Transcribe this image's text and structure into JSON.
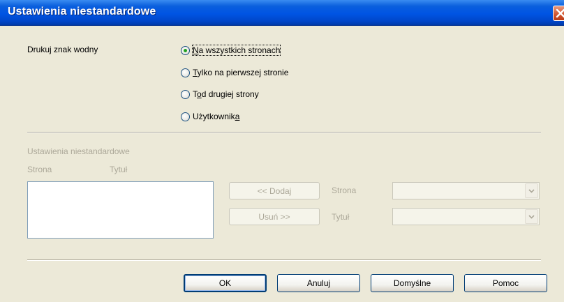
{
  "window": {
    "title": "Ustawienia niestandardowe",
    "close_icon": "close-icon"
  },
  "watermark": {
    "label": "Drukuj znak wodny",
    "options": [
      {
        "pre": "",
        "key": "N",
        "post": "a wszystkich stronach",
        "selected": true
      },
      {
        "pre": "",
        "key": "T",
        "post": "ylko na pierwszej stronie",
        "selected": false
      },
      {
        "pre": "T",
        "key": "o",
        "post": "d drugiej strony",
        "selected": false
      },
      {
        "pre": "Użytkownik",
        "key": "a",
        "post": "",
        "selected": false
      }
    ]
  },
  "custom": {
    "section_label": "Ustawienia niestandardowe",
    "col_page": "Strona",
    "col_title": "Tytuł",
    "add_button": "<< Dodaj",
    "remove_button": "Usuń >>",
    "page_field_label": "Strona",
    "title_field_label": "Tytuł"
  },
  "footer": {
    "ok": "OK",
    "cancel": "Anuluj",
    "default": "Domyślne",
    "help": "Pomoc"
  },
  "colors": {
    "title_bar": "#0054e3",
    "dialog_bg": "#ece9d8",
    "disabled_text": "#aca899"
  }
}
